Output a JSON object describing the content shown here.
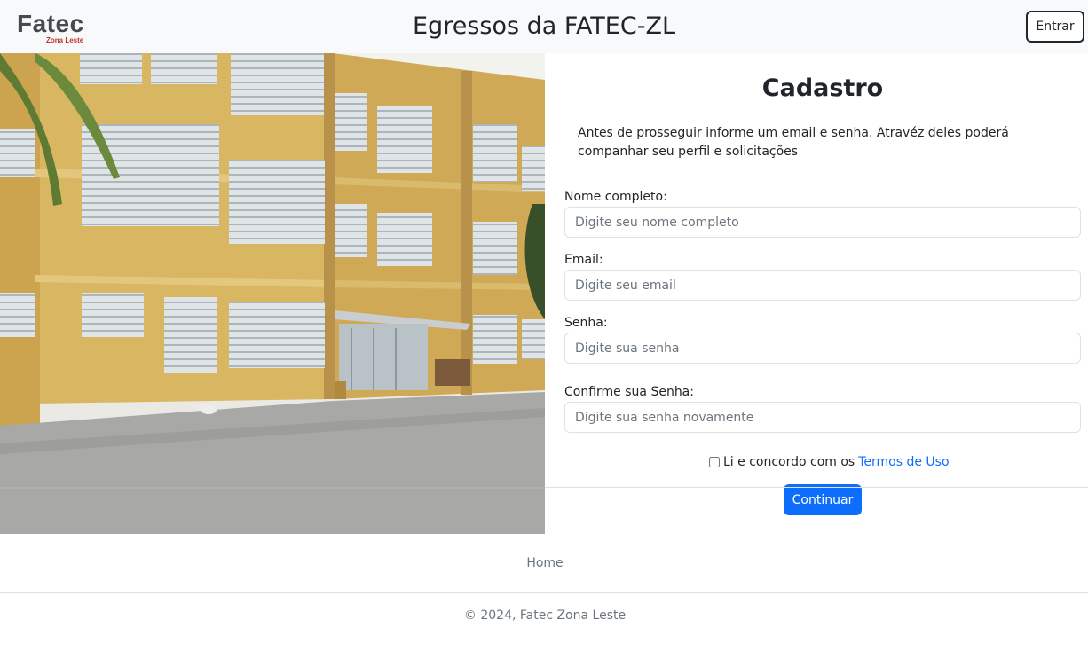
{
  "header": {
    "logo_main": "Fatec",
    "logo_sub": "Zona Leste",
    "title": "Egressos da FATEC-ZL",
    "login_label": "Entrar"
  },
  "form": {
    "title": "Cadastro",
    "intro": "Antes de prosseguir informe um email e senha. Atravéz deles poderá companhar seu perfil e solicitações",
    "fields": [
      {
        "label": "Nome completo:",
        "placeholder": "Digite seu nome completo",
        "value": ""
      },
      {
        "label": "Email:",
        "placeholder": "Digite seu email",
        "value": ""
      },
      {
        "label": "Senha:",
        "placeholder": "Digite sua senha",
        "value": ""
      },
      {
        "label": "Confirme sua Senha:",
        "placeholder": "Digite sua senha novamente",
        "value": ""
      }
    ],
    "terms_text": "Li e concordo com os",
    "terms_link": "Termos de Uso",
    "terms_checked": false,
    "continue_label": "Continuar"
  },
  "footer": {
    "home_link": "Home",
    "copyright": "© 2024, Fatec Zona Leste"
  },
  "colors": {
    "primary": "#0d6efd",
    "header_bg": "#f8f9fa",
    "logo_red": "#c0322f"
  }
}
